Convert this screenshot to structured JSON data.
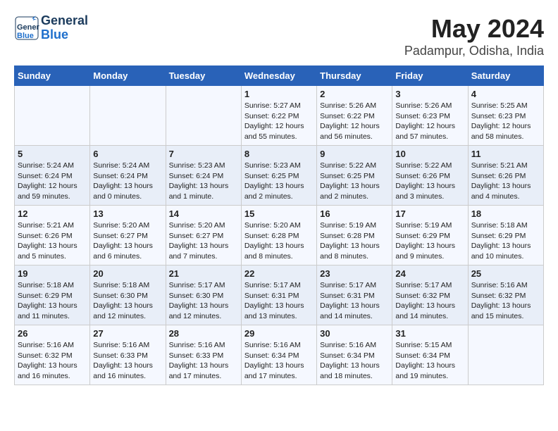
{
  "logo": {
    "line1": "General",
    "line2": "Blue"
  },
  "title": "May 2024",
  "subtitle": "Padampur, Odisha, India",
  "days_of_week": [
    "Sunday",
    "Monday",
    "Tuesday",
    "Wednesday",
    "Thursday",
    "Friday",
    "Saturday"
  ],
  "weeks": [
    [
      {
        "day": "",
        "content": ""
      },
      {
        "day": "",
        "content": ""
      },
      {
        "day": "",
        "content": ""
      },
      {
        "day": "1",
        "content": "Sunrise: 5:27 AM\nSunset: 6:22 PM\nDaylight: 12 hours\nand 55 minutes."
      },
      {
        "day": "2",
        "content": "Sunrise: 5:26 AM\nSunset: 6:22 PM\nDaylight: 12 hours\nand 56 minutes."
      },
      {
        "day": "3",
        "content": "Sunrise: 5:26 AM\nSunset: 6:23 PM\nDaylight: 12 hours\nand 57 minutes."
      },
      {
        "day": "4",
        "content": "Sunrise: 5:25 AM\nSunset: 6:23 PM\nDaylight: 12 hours\nand 58 minutes."
      }
    ],
    [
      {
        "day": "5",
        "content": "Sunrise: 5:24 AM\nSunset: 6:24 PM\nDaylight: 12 hours\nand 59 minutes."
      },
      {
        "day": "6",
        "content": "Sunrise: 5:24 AM\nSunset: 6:24 PM\nDaylight: 13 hours\nand 0 minutes."
      },
      {
        "day": "7",
        "content": "Sunrise: 5:23 AM\nSunset: 6:24 PM\nDaylight: 13 hours\nand 1 minute."
      },
      {
        "day": "8",
        "content": "Sunrise: 5:23 AM\nSunset: 6:25 PM\nDaylight: 13 hours\nand 2 minutes."
      },
      {
        "day": "9",
        "content": "Sunrise: 5:22 AM\nSunset: 6:25 PM\nDaylight: 13 hours\nand 2 minutes."
      },
      {
        "day": "10",
        "content": "Sunrise: 5:22 AM\nSunset: 6:26 PM\nDaylight: 13 hours\nand 3 minutes."
      },
      {
        "day": "11",
        "content": "Sunrise: 5:21 AM\nSunset: 6:26 PM\nDaylight: 13 hours\nand 4 minutes."
      }
    ],
    [
      {
        "day": "12",
        "content": "Sunrise: 5:21 AM\nSunset: 6:26 PM\nDaylight: 13 hours\nand 5 minutes."
      },
      {
        "day": "13",
        "content": "Sunrise: 5:20 AM\nSunset: 6:27 PM\nDaylight: 13 hours\nand 6 minutes."
      },
      {
        "day": "14",
        "content": "Sunrise: 5:20 AM\nSunset: 6:27 PM\nDaylight: 13 hours\nand 7 minutes."
      },
      {
        "day": "15",
        "content": "Sunrise: 5:20 AM\nSunset: 6:28 PM\nDaylight: 13 hours\nand 8 minutes."
      },
      {
        "day": "16",
        "content": "Sunrise: 5:19 AM\nSunset: 6:28 PM\nDaylight: 13 hours\nand 8 minutes."
      },
      {
        "day": "17",
        "content": "Sunrise: 5:19 AM\nSunset: 6:29 PM\nDaylight: 13 hours\nand 9 minutes."
      },
      {
        "day": "18",
        "content": "Sunrise: 5:18 AM\nSunset: 6:29 PM\nDaylight: 13 hours\nand 10 minutes."
      }
    ],
    [
      {
        "day": "19",
        "content": "Sunrise: 5:18 AM\nSunset: 6:29 PM\nDaylight: 13 hours\nand 11 minutes."
      },
      {
        "day": "20",
        "content": "Sunrise: 5:18 AM\nSunset: 6:30 PM\nDaylight: 13 hours\nand 12 minutes."
      },
      {
        "day": "21",
        "content": "Sunrise: 5:17 AM\nSunset: 6:30 PM\nDaylight: 13 hours\nand 12 minutes."
      },
      {
        "day": "22",
        "content": "Sunrise: 5:17 AM\nSunset: 6:31 PM\nDaylight: 13 hours\nand 13 minutes."
      },
      {
        "day": "23",
        "content": "Sunrise: 5:17 AM\nSunset: 6:31 PM\nDaylight: 13 hours\nand 14 minutes."
      },
      {
        "day": "24",
        "content": "Sunrise: 5:17 AM\nSunset: 6:32 PM\nDaylight: 13 hours\nand 14 minutes."
      },
      {
        "day": "25",
        "content": "Sunrise: 5:16 AM\nSunset: 6:32 PM\nDaylight: 13 hours\nand 15 minutes."
      }
    ],
    [
      {
        "day": "26",
        "content": "Sunrise: 5:16 AM\nSunset: 6:32 PM\nDaylight: 13 hours\nand 16 minutes."
      },
      {
        "day": "27",
        "content": "Sunrise: 5:16 AM\nSunset: 6:33 PM\nDaylight: 13 hours\nand 16 minutes."
      },
      {
        "day": "28",
        "content": "Sunrise: 5:16 AM\nSunset: 6:33 PM\nDaylight: 13 hours\nand 17 minutes."
      },
      {
        "day": "29",
        "content": "Sunrise: 5:16 AM\nSunset: 6:34 PM\nDaylight: 13 hours\nand 17 minutes."
      },
      {
        "day": "30",
        "content": "Sunrise: 5:16 AM\nSunset: 6:34 PM\nDaylight: 13 hours\nand 18 minutes."
      },
      {
        "day": "31",
        "content": "Sunrise: 5:15 AM\nSunset: 6:34 PM\nDaylight: 13 hours\nand 19 minutes."
      },
      {
        "day": "",
        "content": ""
      }
    ]
  ]
}
